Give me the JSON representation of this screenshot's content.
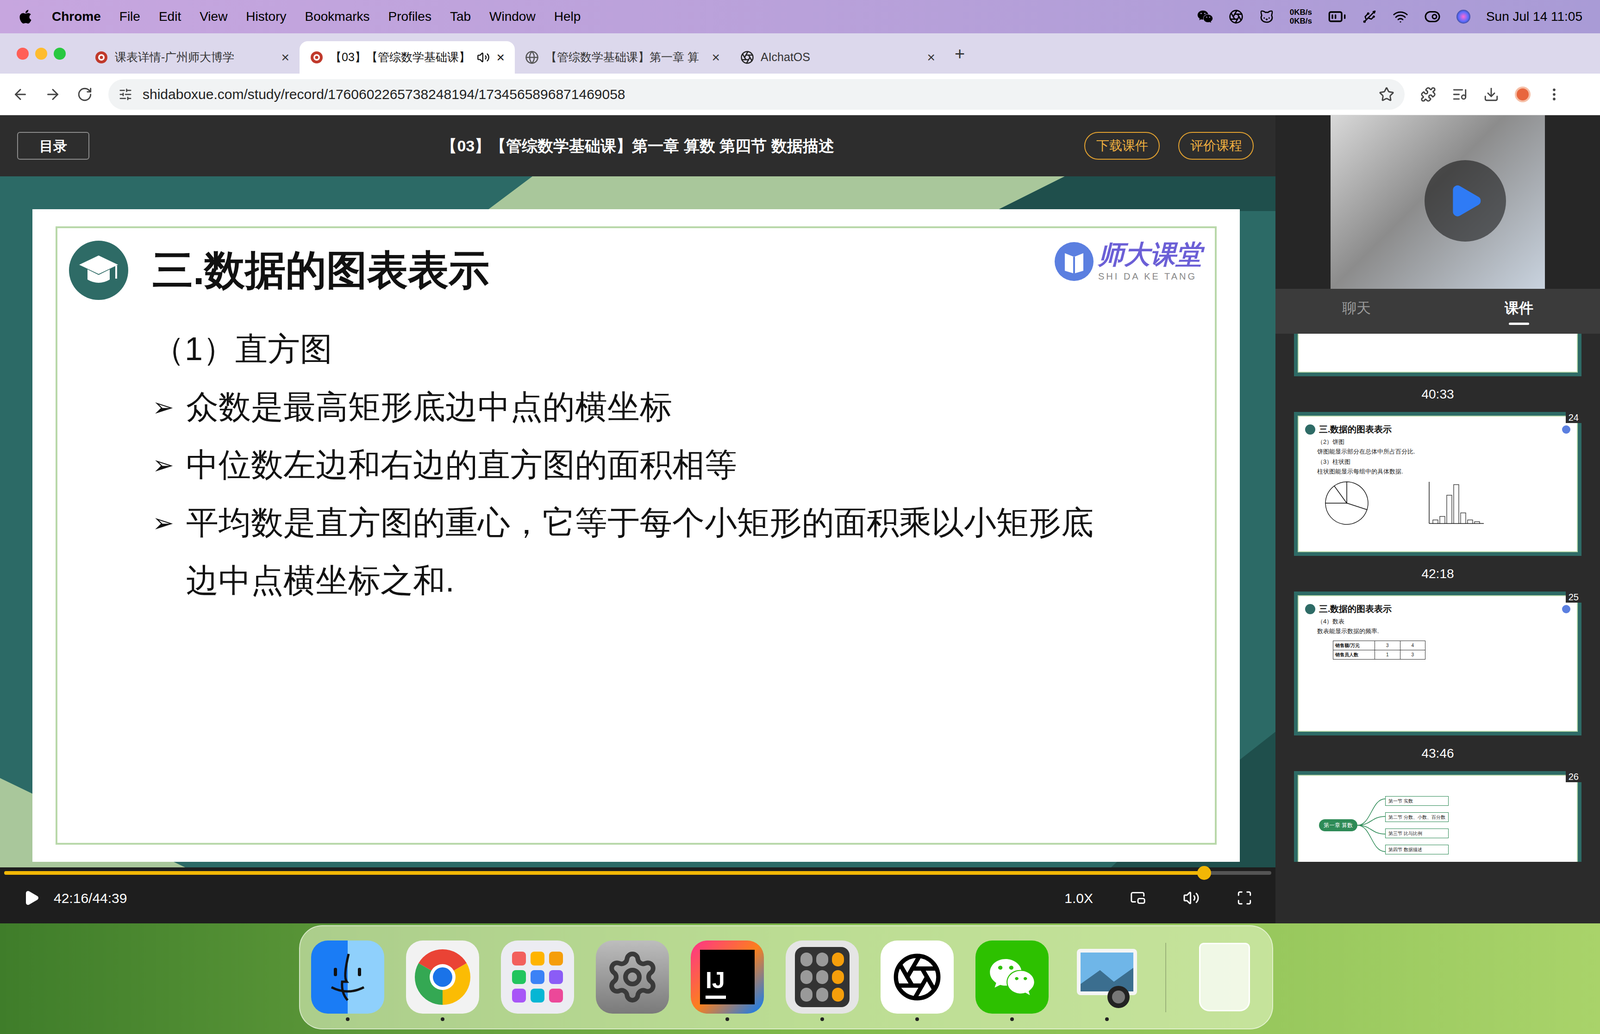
{
  "menubar": {
    "app": "Chrome",
    "items": [
      "File",
      "Edit",
      "View",
      "History",
      "Bookmarks",
      "Profiles",
      "Tab",
      "Window",
      "Help"
    ],
    "net": [
      "0KB/s",
      "0KB/s"
    ],
    "clock": "Sun Jul 14 11:05"
  },
  "tabs": [
    {
      "label": "课表详情-广州师大博学",
      "icon": "site",
      "selected": false,
      "audio": false,
      "close": "×"
    },
    {
      "label": "【03】【管综数学基础课】",
      "icon": "site",
      "selected": true,
      "audio": true,
      "close": "×"
    },
    {
      "label": "【管综数学基础课】第一章 算",
      "icon": "globe",
      "selected": false,
      "audio": false,
      "close": "×"
    },
    {
      "label": "AIchatOS",
      "icon": "openai",
      "selected": false,
      "audio": false,
      "close": "×"
    }
  ],
  "new_tab": "+",
  "address": {
    "url": "shidaboxue.com/study/record/1760602265738248194/1734565896871469058",
    "bookmarked": false
  },
  "page": {
    "catalog": "目录",
    "title": "【03】【管综数学基础课】第一章 算数 第四节 数据描述",
    "download": "下载课件",
    "rate": "评价课程"
  },
  "slide": {
    "title": "三.数据的图表表示",
    "logo": {
      "name": "师大课堂",
      "pinyin": "SHI DA KE TANG"
    },
    "section": "（1）直方图",
    "marker": "➢",
    "bullets": [
      "众数是最高矩形底边中点的横坐标",
      "中位数左边和右边的直方图的面积相等",
      "平均数是直方图的重心，它等于每个小矩形的面积乘以小矩形底边中点横坐标之和."
    ]
  },
  "player": {
    "playing": false,
    "level": 0.947,
    "time": "42:16/44:39",
    "speed": "1.0X"
  },
  "side": {
    "tabs": [
      {
        "label": "聊天",
        "selected": false
      },
      {
        "label": "课件",
        "selected": true
      }
    ],
    "thumbnails": [
      {
        "kind": "partial",
        "time": "40:33"
      },
      {
        "kind": "charts",
        "number": "24",
        "time": "42:18",
        "title": "三.数据的图表表示",
        "lines": [
          "（2）饼图",
          "饼图能显示部分在总体中所占百分比.",
          "（3）柱状图",
          "柱状图能显示每组中的具体数据."
        ],
        "pie": [
          30,
          45,
          15,
          10
        ],
        "bars": [
          1,
          2,
          8,
          11,
          3,
          1,
          0.5
        ]
      },
      {
        "kind": "table",
        "number": "25",
        "time": "43:46",
        "title": "三.数据的图表表示",
        "lines": [
          "（4）数表",
          "数表能显示数据的频率."
        ],
        "table": [
          [
            "销售额/万元",
            "3",
            "4"
          ],
          [
            "销售员人数",
            "1",
            "3"
          ]
        ]
      },
      {
        "kind": "mindmap",
        "number": "26",
        "root": "第一章 算数",
        "branches": [
          "第一节 实数",
          "第二节 分数、小数、百分数",
          "第三节 比与比例",
          "第四节 数据描述"
        ]
      }
    ]
  },
  "dock": [
    {
      "kind": "finder",
      "running": true
    },
    {
      "kind": "chrome",
      "running": true
    },
    {
      "kind": "launchpad",
      "running": false
    },
    {
      "kind": "settings",
      "running": false
    },
    {
      "kind": "intellij",
      "glyph": "IJ",
      "running": true
    },
    {
      "kind": "calculator",
      "running": true
    },
    {
      "kind": "chatgpt",
      "running": true
    },
    {
      "kind": "wechat",
      "running": true
    },
    {
      "kind": "preview",
      "running": true
    },
    {
      "kind": "trash",
      "running": false
    }
  ]
}
